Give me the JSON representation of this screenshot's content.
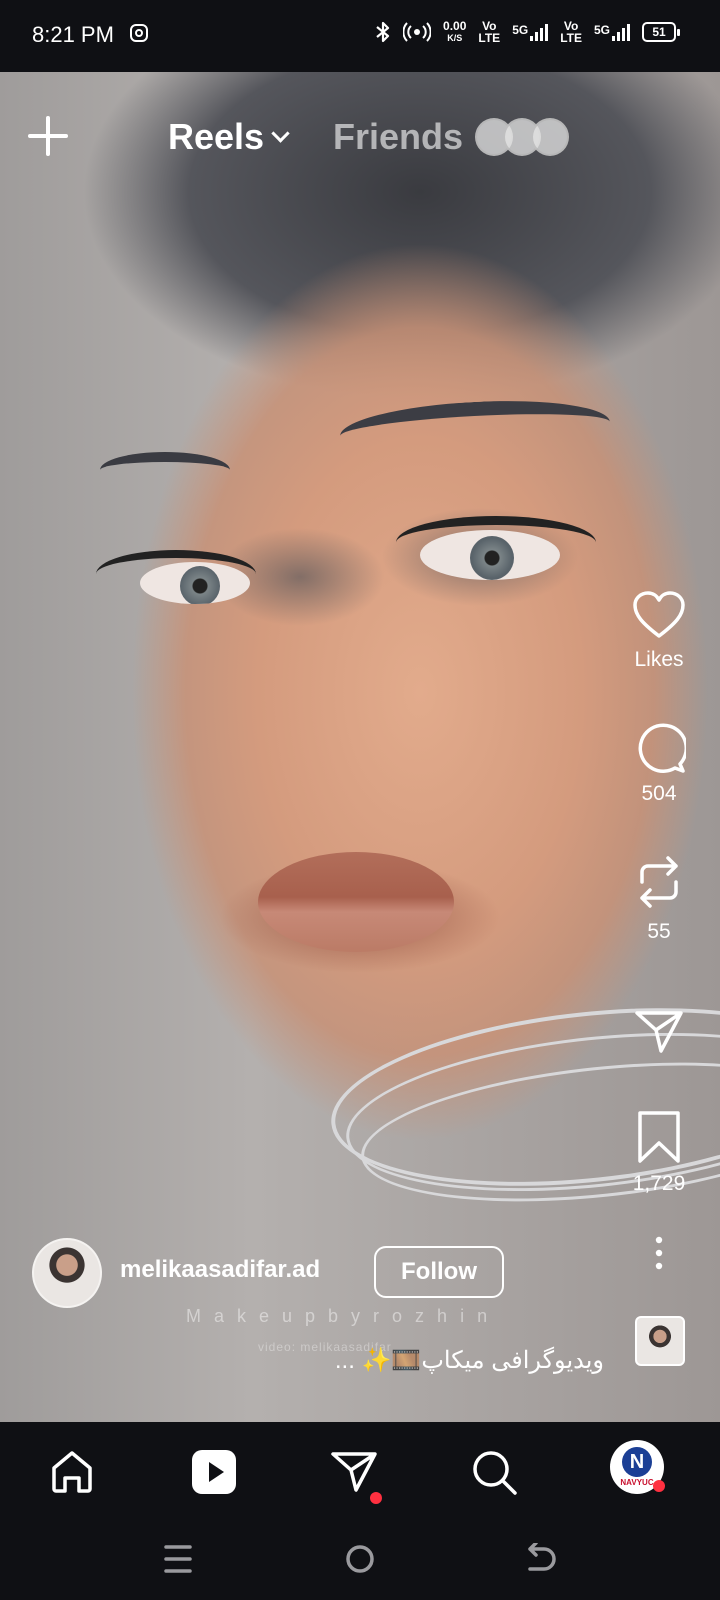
{
  "status_bar": {
    "time": "8:21 PM",
    "net_speed_value": "0.00",
    "net_speed_unit": "K/S",
    "sim1_label_top": "Vo",
    "sim1_label_bottom": "LTE",
    "sim1_tech": "5G",
    "sim2_label_top": "Vo",
    "sim2_label_bottom": "LTE",
    "sim2_tech": "5G",
    "battery": "51",
    "icons": [
      "instagram-icon",
      "bluetooth-icon",
      "hotspot-icon",
      "signal-icon",
      "battery-icon"
    ]
  },
  "top_nav": {
    "create_icon": "plus-icon",
    "reels_tab": "Reels",
    "friends_tab": "Friends"
  },
  "action_rail": {
    "likes_label": "Likes",
    "comments_count": "504",
    "reposts_count": "55",
    "saves_count": "1,729",
    "icons": [
      "heart-icon",
      "comment-icon",
      "repost-icon",
      "share-icon",
      "bookmark-icon",
      "more-icon"
    ]
  },
  "reel": {
    "username": "melikaasadifar.ad",
    "follow_label": "Follow",
    "watermark": "Makeupbyrozhin",
    "watermark_credit": "video: melikaasadifar",
    "caption": "ویدیوگرافی میکاپ🎞️✨ ..."
  },
  "bottom_nav": {
    "icons": [
      "home-icon",
      "reels-icon",
      "messages-icon",
      "search-icon",
      "profile-avatar"
    ],
    "profile_badge": "N",
    "profile_text": "NAVYUC",
    "accent_red": "#ff3040"
  },
  "system_nav": {
    "icons": [
      "recents-icon",
      "home-circle-icon",
      "back-icon"
    ]
  }
}
